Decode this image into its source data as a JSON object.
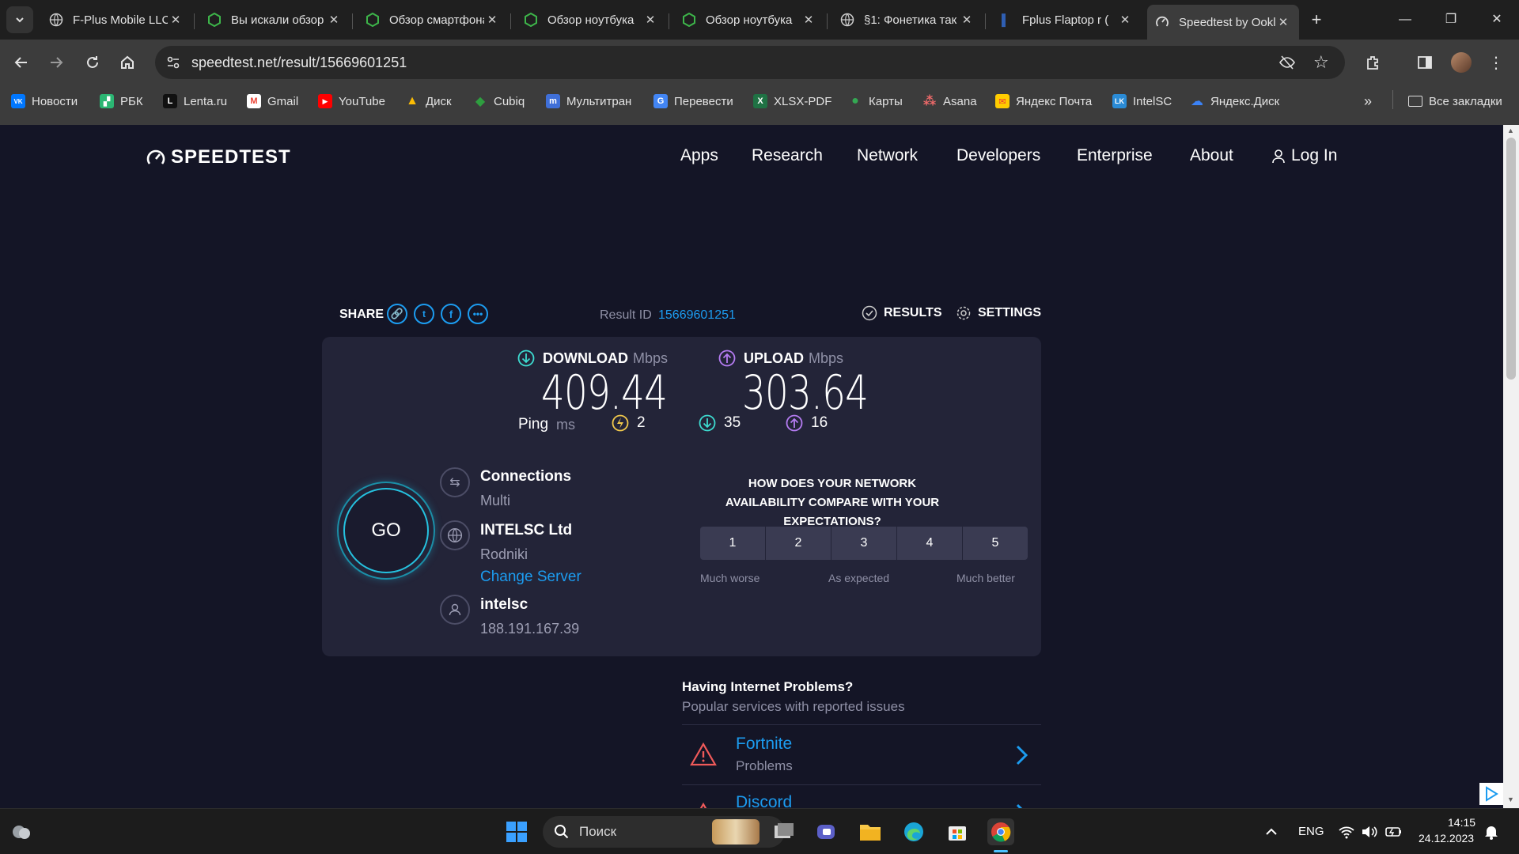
{
  "browser": {
    "tabs": [
      {
        "title": "F-Plus Mobile LLC",
        "icon": "globe-icon",
        "active": false
      },
      {
        "title": "Вы искали обзор",
        "icon": "shield-green-icon",
        "active": false
      },
      {
        "title": "Обзор смартфона",
        "icon": "shield-green-icon",
        "active": false
      },
      {
        "title": "Обзор ноутбука",
        "icon": "shield-green-icon",
        "active": false
      },
      {
        "title": "Обзор ноутбука",
        "icon": "shield-green-icon",
        "active": false
      },
      {
        "title": "§1: Фонетика так",
        "icon": "globe-icon",
        "active": false
      },
      {
        "title": "Fplus Flaptop r (",
        "icon": "fplus-icon",
        "active": false
      },
      {
        "title": "Speedtest by Ookla",
        "icon": "speedtest-icon",
        "active": true
      }
    ],
    "url": "speedtest.net/result/15669601251",
    "bookmarks": [
      {
        "label": "Новости",
        "icon": "vk-icon",
        "color": "#0077ff",
        "glyph": "VK"
      },
      {
        "label": "РБК",
        "icon": "rbc-icon",
        "color": "#2bb673",
        "glyph": "▞"
      },
      {
        "label": "Lenta.ru",
        "icon": "lenta-icon",
        "color": "#1b1b1b",
        "glyph": "L"
      },
      {
        "label": "Gmail",
        "icon": "gmail-icon",
        "color": "#ea4335",
        "glyph": "M"
      },
      {
        "label": "YouTube",
        "icon": "youtube-icon",
        "color": "#ff0000",
        "glyph": "▶"
      },
      {
        "label": "Диск",
        "icon": "google-drive-icon",
        "color": "#fbbc04",
        "glyph": "▲"
      },
      {
        "label": "Cubiq",
        "icon": "cubiq-icon",
        "color": "#2e9e3f",
        "glyph": "◆"
      },
      {
        "label": "Мультитран",
        "icon": "multitran-icon",
        "color": "#3f6fd8",
        "glyph": "m"
      },
      {
        "label": "Перевести",
        "icon": "translate-icon",
        "color": "#4285f4",
        "glyph": "G"
      },
      {
        "label": "XLSX-PDF",
        "icon": "xlsx-icon",
        "color": "#1f7244",
        "glyph": "X"
      },
      {
        "label": "Карты",
        "icon": "maps-icon",
        "color": "#34a853",
        "glyph": "●"
      },
      {
        "label": "Asana",
        "icon": "asana-icon",
        "color": "#f06a6a",
        "glyph": "⁂"
      },
      {
        "label": "Яндекс Почта",
        "icon": "yandex-mail-icon",
        "color": "#ffcc00",
        "glyph": "✉"
      },
      {
        "label": "IntelSC",
        "icon": "intelsc-icon",
        "color": "#2a8bd6",
        "glyph": "LK"
      },
      {
        "label": "Яндекс.Диск",
        "icon": "yandex-disk-icon",
        "color": "#3b82f6",
        "glyph": "☁"
      }
    ],
    "all_bookmarks": "Все закладки"
  },
  "site": {
    "logo": "SPEEDTEST",
    "nav": [
      "Apps",
      "Research",
      "Network",
      "Developers",
      "Enterprise",
      "About"
    ],
    "login": "Log In"
  },
  "result": {
    "share_label": "SHARE",
    "result_id_label": "Result ID",
    "result_id": "15669601251",
    "results_label": "RESULTS",
    "settings_label": "SETTINGS",
    "download_label": "DOWNLOAD",
    "upload_label": "UPLOAD",
    "unit": "Mbps",
    "download_value": "409.44",
    "upload_value": "303.64",
    "ping_label": "Ping",
    "ping_unit": "ms",
    "ping_idle": "2",
    "ping_download": "35",
    "ping_upload": "16",
    "go_label": "GO",
    "connections_title": "Connections",
    "connections_value": "Multi",
    "isp_title": "INTELSC Ltd",
    "isp_location": "Rodniki",
    "change_server": "Change Server",
    "user_title": "intelsc",
    "user_ip": "188.191.167.39",
    "survey_question": "HOW DOES YOUR NETWORK AVAILABILITY COMPARE WITH YOUR EXPECTATIONS?",
    "ratings": [
      "1",
      "2",
      "3",
      "4",
      "5"
    ],
    "rating_low": "Much worse",
    "rating_mid": "As expected",
    "rating_high": "Much better"
  },
  "problems": {
    "title": "Having Internet Problems?",
    "subtitle": "Popular services with reported issues",
    "items": [
      {
        "name": "Fortnite",
        "status": "Problems"
      },
      {
        "name": "Discord",
        "status": ""
      }
    ]
  },
  "taskbar": {
    "search_placeholder": "Поиск",
    "lang": "ENG",
    "time": "14:15",
    "date": "24.12.2023"
  }
}
